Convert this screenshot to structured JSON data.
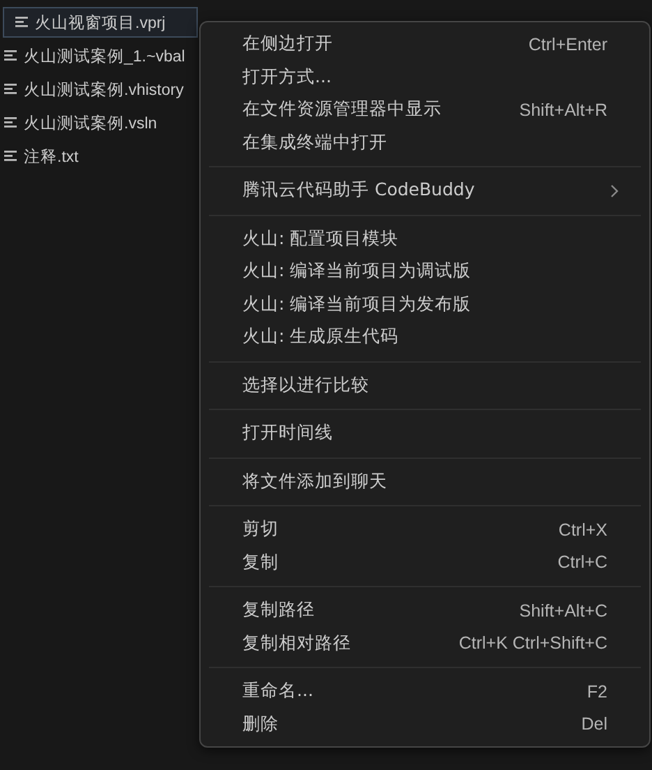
{
  "files": [
    {
      "name": "火山视窗项目.vprj",
      "selected": true
    },
    {
      "name": "火山测试案例_1.~vbal",
      "selected": false
    },
    {
      "name": "火山测试案例.vhistory",
      "selected": false
    },
    {
      "name": "火山测试案例.vsln",
      "selected": false
    },
    {
      "name": "注释.txt",
      "selected": false
    }
  ],
  "context_menu": {
    "groups": [
      [
        {
          "kind": "item",
          "label": "在侧边打开",
          "shortcut": "Ctrl+Enter"
        },
        {
          "kind": "item",
          "label": "打开方式..."
        },
        {
          "kind": "item",
          "label": "在文件资源管理器中显示",
          "shortcut": "Shift+Alt+R"
        },
        {
          "kind": "item",
          "label": "在集成终端中打开"
        }
      ],
      [
        {
          "kind": "submenu",
          "label": "腾讯云代码助手 CodeBuddy"
        }
      ],
      [
        {
          "kind": "item",
          "label": "火山: 配置项目模块"
        },
        {
          "kind": "item",
          "label": "火山: 编译当前项目为调试版"
        },
        {
          "kind": "item",
          "label": "火山: 编译当前项目为发布版"
        },
        {
          "kind": "item",
          "label": "火山: 生成原生代码"
        }
      ],
      [
        {
          "kind": "item",
          "label": "选择以进行比较"
        }
      ],
      [
        {
          "kind": "item",
          "label": "打开时间线"
        }
      ],
      [
        {
          "kind": "item",
          "label": "将文件添加到聊天"
        }
      ],
      [
        {
          "kind": "item",
          "label": "剪切",
          "shortcut": "Ctrl+X"
        },
        {
          "kind": "item",
          "label": "复制",
          "shortcut": "Ctrl+C"
        }
      ],
      [
        {
          "kind": "item",
          "label": "复制路径",
          "shortcut": "Shift+Alt+C"
        },
        {
          "kind": "item",
          "label": "复制相对路径",
          "shortcut": "Ctrl+K Ctrl+Shift+C"
        }
      ],
      [
        {
          "kind": "item",
          "label": "重命名...",
          "shortcut": "F2"
        },
        {
          "kind": "item",
          "label": "删除",
          "shortcut": "Del"
        }
      ]
    ]
  }
}
